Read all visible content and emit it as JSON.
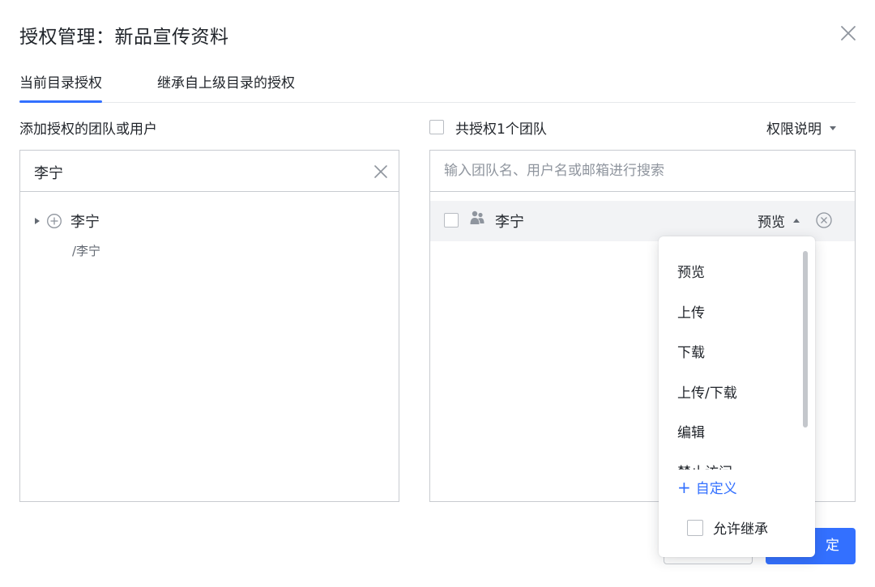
{
  "dialog": {
    "title": "授权管理：新品宣传资料"
  },
  "tabs": [
    {
      "label": "当前目录授权",
      "active": true
    },
    {
      "label": "继承自上级目录的授权",
      "active": false
    }
  ],
  "left": {
    "label": "添加授权的团队或用户",
    "search_value": "李宁",
    "result": {
      "name": "李宁",
      "path": "/李宁"
    }
  },
  "right": {
    "share_label": "共授权1个团队",
    "perm_desc_label": "权限说明",
    "search_placeholder": "输入团队名、用户名或邮箱进行搜索",
    "member": {
      "name": "李宁",
      "permission": "预览"
    }
  },
  "dropdown": {
    "options": [
      "预览",
      "上传",
      "下载",
      "上传/下载",
      "编辑",
      "禁止访问"
    ],
    "custom_label": "自定义",
    "inherit_label": "允许继承"
  },
  "buttons": {
    "confirm_label": "定"
  },
  "colors": {
    "accent": "#3370ff",
    "row_bg": "#f2f3f5",
    "border": "#c8cbd0"
  }
}
